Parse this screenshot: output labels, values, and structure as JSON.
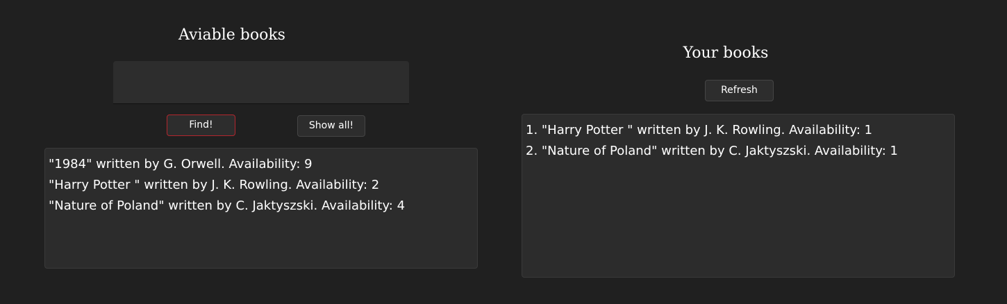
{
  "available": {
    "title": "Aviable books",
    "search": {
      "value": "",
      "placeholder": ""
    },
    "find_label": "Find!",
    "show_all_label": "Show all!",
    "items": [
      "\"1984\" written by G. Orwell. Availability: 9",
      "\"Harry Potter \" written by J. K. Rowling. Availability: 2",
      "\"Nature of Poland\" written by C. Jaktyszski. Availability: 4"
    ]
  },
  "yours": {
    "title": "Your books",
    "refresh_label": "Refresh",
    "items": [
      "1. \"Harry Potter \" written by J. K. Rowling. Availability: 1",
      "2. \"Nature of Poland\" written by C. Jaktyszski. Availability: 1"
    ]
  },
  "colors": {
    "background": "#202020",
    "panel": "#2c2c2c",
    "accent_border": "#b4262d",
    "text": "#ffffff"
  }
}
